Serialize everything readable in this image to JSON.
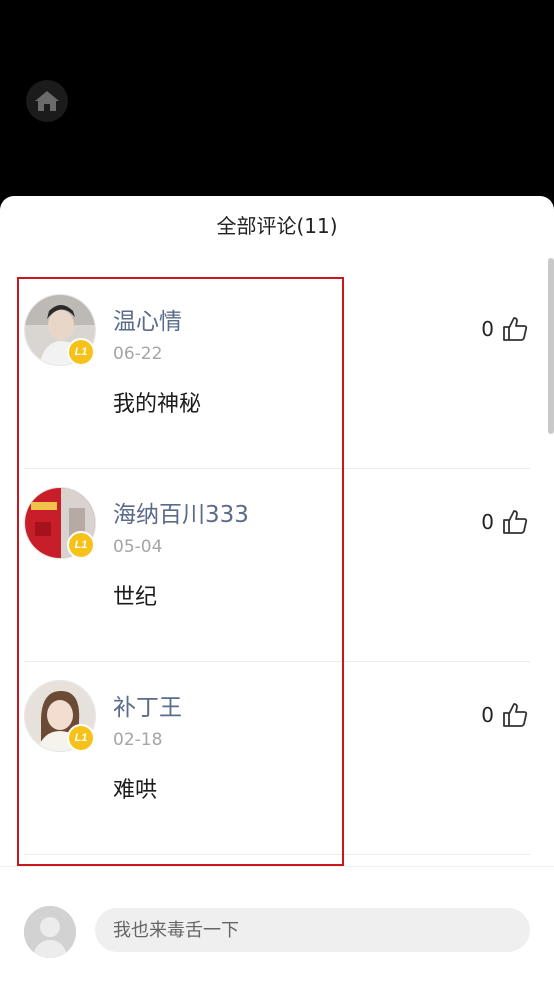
{
  "header": {
    "title": "全部评论(11)"
  },
  "comments": [
    {
      "username": "温心情",
      "date": "06-22",
      "text": "我的神秘",
      "likes": "0",
      "level": "L1"
    },
    {
      "username": "海纳百川333",
      "date": "05-04",
      "text": "世纪",
      "likes": "0",
      "level": "L1"
    },
    {
      "username": "补丁王",
      "date": "02-18",
      "text": "难哄",
      "likes": "0",
      "level": "L1"
    }
  ],
  "input": {
    "placeholder": "我也来毒舌一下"
  },
  "colors": {
    "accent_red": "#c8181e",
    "username": "#5b6b8c",
    "badge": "#f6c21a"
  }
}
